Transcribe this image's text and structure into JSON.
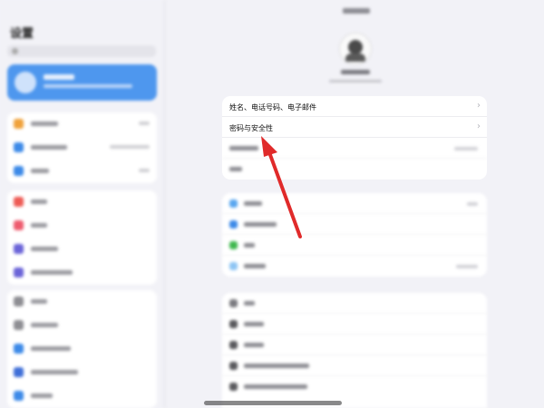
{
  "account_section": {
    "items": [
      {
        "label": "姓名、电话号码、电子邮件"
      },
      {
        "label": "密码与安全性"
      }
    ]
  },
  "colors": {
    "accent": "#4e97ee",
    "annotation_arrow": "#e02a2a"
  },
  "icons": {
    "chevron": "›"
  }
}
